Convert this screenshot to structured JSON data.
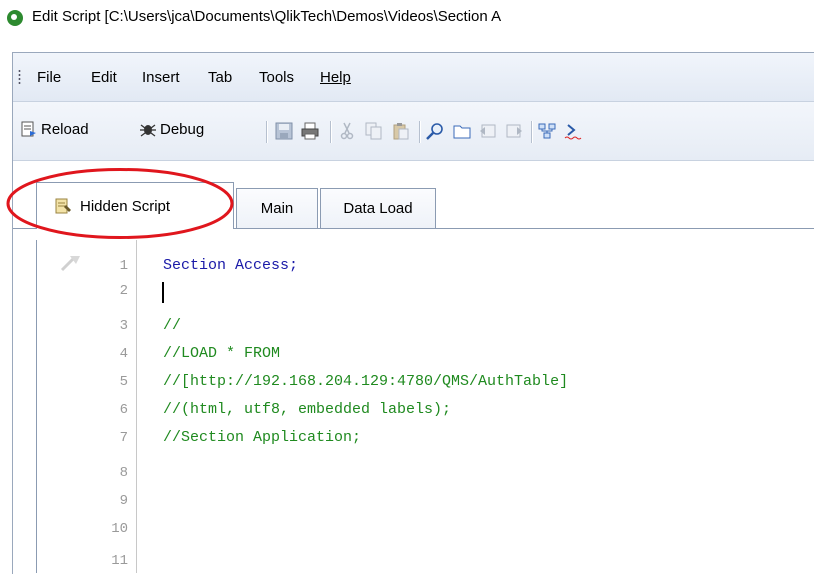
{
  "window": {
    "title": "Edit Script [C:\\Users\\jca\\Documents\\QlikTech\\Demos\\Videos\\Section A"
  },
  "menu": {
    "items": [
      "File",
      "Edit",
      "Insert",
      "Tab",
      "Tools",
      "Help"
    ]
  },
  "toolbar": {
    "reload_label": "Reload",
    "debug_label": "Debug",
    "icons": [
      "save-icon",
      "print-icon",
      "cut-icon",
      "copy-icon",
      "paste-icon",
      "find-icon",
      "new-tab-icon",
      "tab-left-icon",
      "tab-right-icon",
      "table-viewer-icon",
      "syntax-check-icon"
    ]
  },
  "tabs": [
    {
      "label": "Hidden Script",
      "active": true
    },
    {
      "label": "Main",
      "active": false
    },
    {
      "label": "Data Load",
      "active": false
    }
  ],
  "editor": {
    "line_numbers": [
      "1",
      "2",
      "3",
      "4",
      "5",
      "6",
      "7",
      "8",
      "9",
      "10",
      "11"
    ],
    "lines": [
      {
        "text": "Section Access;",
        "style": "keyword"
      },
      {
        "text": "",
        "style": "plain"
      },
      {
        "text": "//",
        "style": "comment"
      },
      {
        "text": "//LOAD * FROM",
        "style": "comment"
      },
      {
        "text": "//[http://192.168.204.129:4780/QMS/AuthTable]",
        "style": "comment"
      },
      {
        "text": "//(html, utf8, embedded labels);",
        "style": "comment"
      },
      {
        "text": "//Section Application;",
        "style": "comment"
      }
    ]
  },
  "colors": {
    "keyword": "#1a1aa8",
    "comment": "#1f8a1f",
    "annotation": "#e0161d"
  }
}
